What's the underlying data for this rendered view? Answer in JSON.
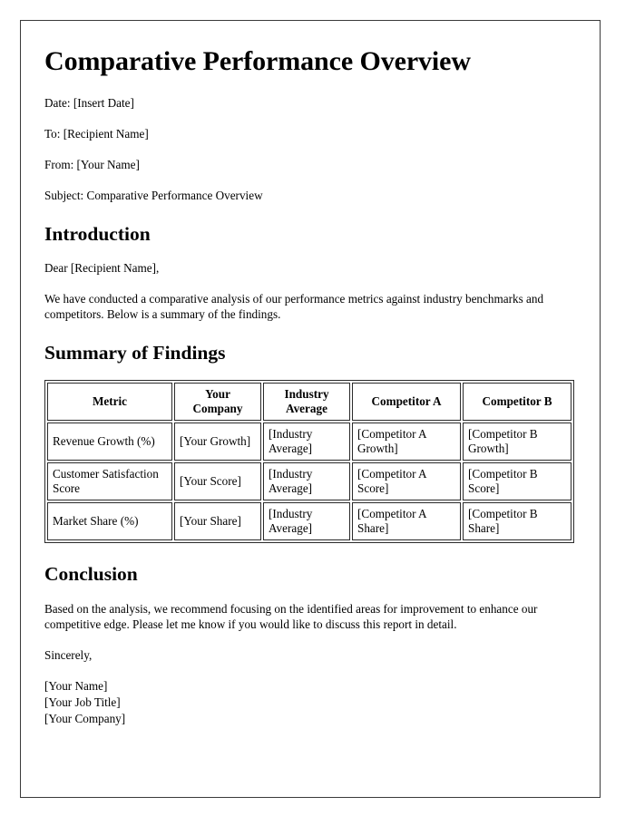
{
  "document": {
    "title": "Comparative Performance Overview",
    "meta": [
      "Date: [Insert Date]",
      "To: [Recipient Name]",
      "From: [Your Name]",
      "Subject: Comparative Performance Overview"
    ],
    "introduction": {
      "heading": "Introduction",
      "salutation": "Dear [Recipient Name],",
      "paragraph": "We have conducted a comparative analysis of our performance metrics against industry benchmarks and competitors. Below is a summary of the findings."
    },
    "summary": {
      "heading": "Summary of Findings",
      "table": {
        "columns": [
          "Metric",
          "Your Company",
          "Industry Average",
          "Competitor A",
          "Competitor B"
        ],
        "rows": [
          [
            "Revenue Growth (%)",
            "[Your Growth]",
            "[Industry Average]",
            "[Competitor A Growth]",
            "[Competitor B Growth]"
          ],
          [
            "Customer Satisfaction Score",
            "[Your Score]",
            "[Industry Average]",
            "[Competitor A Score]",
            "[Competitor B Score]"
          ],
          [
            "Market Share (%)",
            "[Your Share]",
            "[Industry Average]",
            "[Competitor A Share]",
            "[Competitor B Share]"
          ]
        ]
      }
    },
    "conclusion": {
      "heading": "Conclusion",
      "paragraph": "Based on the analysis, we recommend focusing on the identified areas for improvement to enhance our competitive edge. Please let me know if you would like to discuss this report in detail.",
      "closing": "Sincerely,",
      "signature": [
        "[Your Name]",
        "[Your Job Title]",
        "[Your Company]"
      ]
    }
  },
  "colors": {
    "page_border": "#3a3a3a",
    "table_border": "#2b2b2b",
    "text": "#000000",
    "background": "#ffffff"
  }
}
